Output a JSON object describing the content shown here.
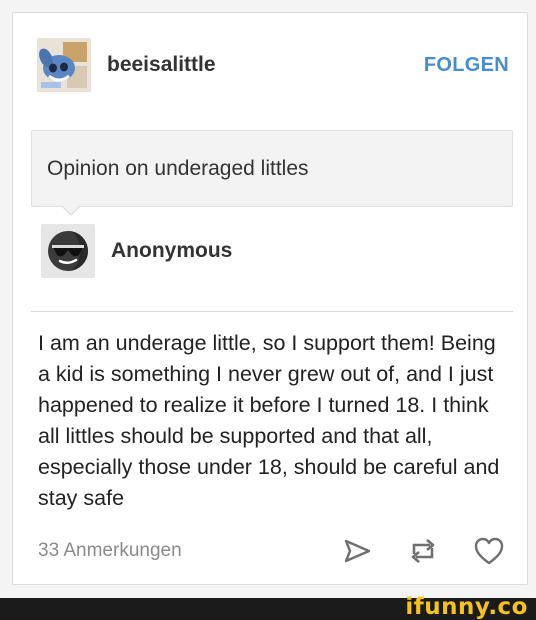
{
  "post": {
    "blog_name": "beeisalittle",
    "follow_label": "FOLGEN",
    "question": "Opinion on underaged littles",
    "asker": "Anonymous",
    "answer": "I am an underage little, so I support them! Being a kid is something I never grew out of, and I just happened to realize it before I turned 18. I think all littles should be supported and that all, especially those under 18, should be careful and stay safe",
    "notes": "33 Anmerkungen"
  },
  "icons": {
    "blog_avatar": "stitch-avatar",
    "asker_avatar": "anonymous-sunglasses-avatar",
    "share": "send-icon",
    "reblog": "reblog-icon",
    "like": "heart-icon"
  },
  "watermark": "ifunny.co",
  "colors": {
    "accent": "#4a8cc7",
    "muted_text": "#8a8a8a",
    "watermark": "#f6c21c"
  }
}
